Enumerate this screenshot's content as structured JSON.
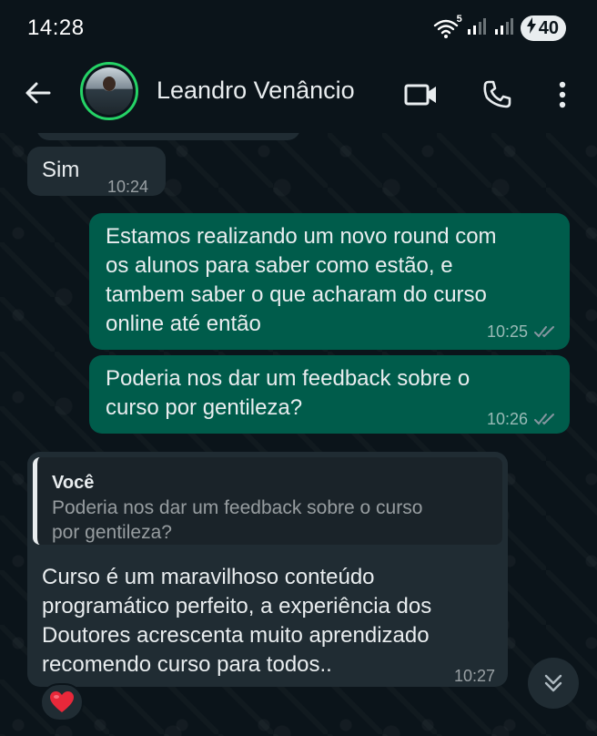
{
  "status_bar": {
    "time": "14:28",
    "battery": "40",
    "network_badge": "5"
  },
  "header": {
    "contact_name": "Leandro Venâncio",
    "icons": [
      "back-arrow-icon",
      "video-call-icon",
      "voice-call-icon",
      "more-options-icon"
    ],
    "avatar_ring_color": "#25d366"
  },
  "messages": [
    {
      "direction": "in",
      "text": "Sim",
      "time": "10:24"
    },
    {
      "direction": "out",
      "lines": [
        "Estamos realizando um novo round com",
        "os alunos para saber como estão, e",
        "tambem saber o que acharam do curso",
        "online até então"
      ],
      "time": "10:25",
      "status": "read"
    },
    {
      "direction": "out",
      "lines": [
        "Poderia nos dar um feedback sobre o",
        "curso por gentileza?"
      ],
      "time": "10:26",
      "status": "read"
    },
    {
      "direction": "in",
      "quote": {
        "author": "Você",
        "lines": [
          "Poderia nos dar um feedback sobre o curso",
          "por gentileza?"
        ]
      },
      "lines": [
        "Curso é um maravilhoso conteúdo",
        "programático perfeito, a experiência dos",
        "Doutores acrescenta muito aprendizado",
        "recomendo curso para todos.."
      ],
      "time": "10:27",
      "reaction": "❤️"
    }
  ],
  "colors": {
    "background": "#0b141a",
    "incoming_bubble": "#202c33",
    "outgoing_bubble": "#005c4b",
    "read_tick": "#8696a0"
  }
}
